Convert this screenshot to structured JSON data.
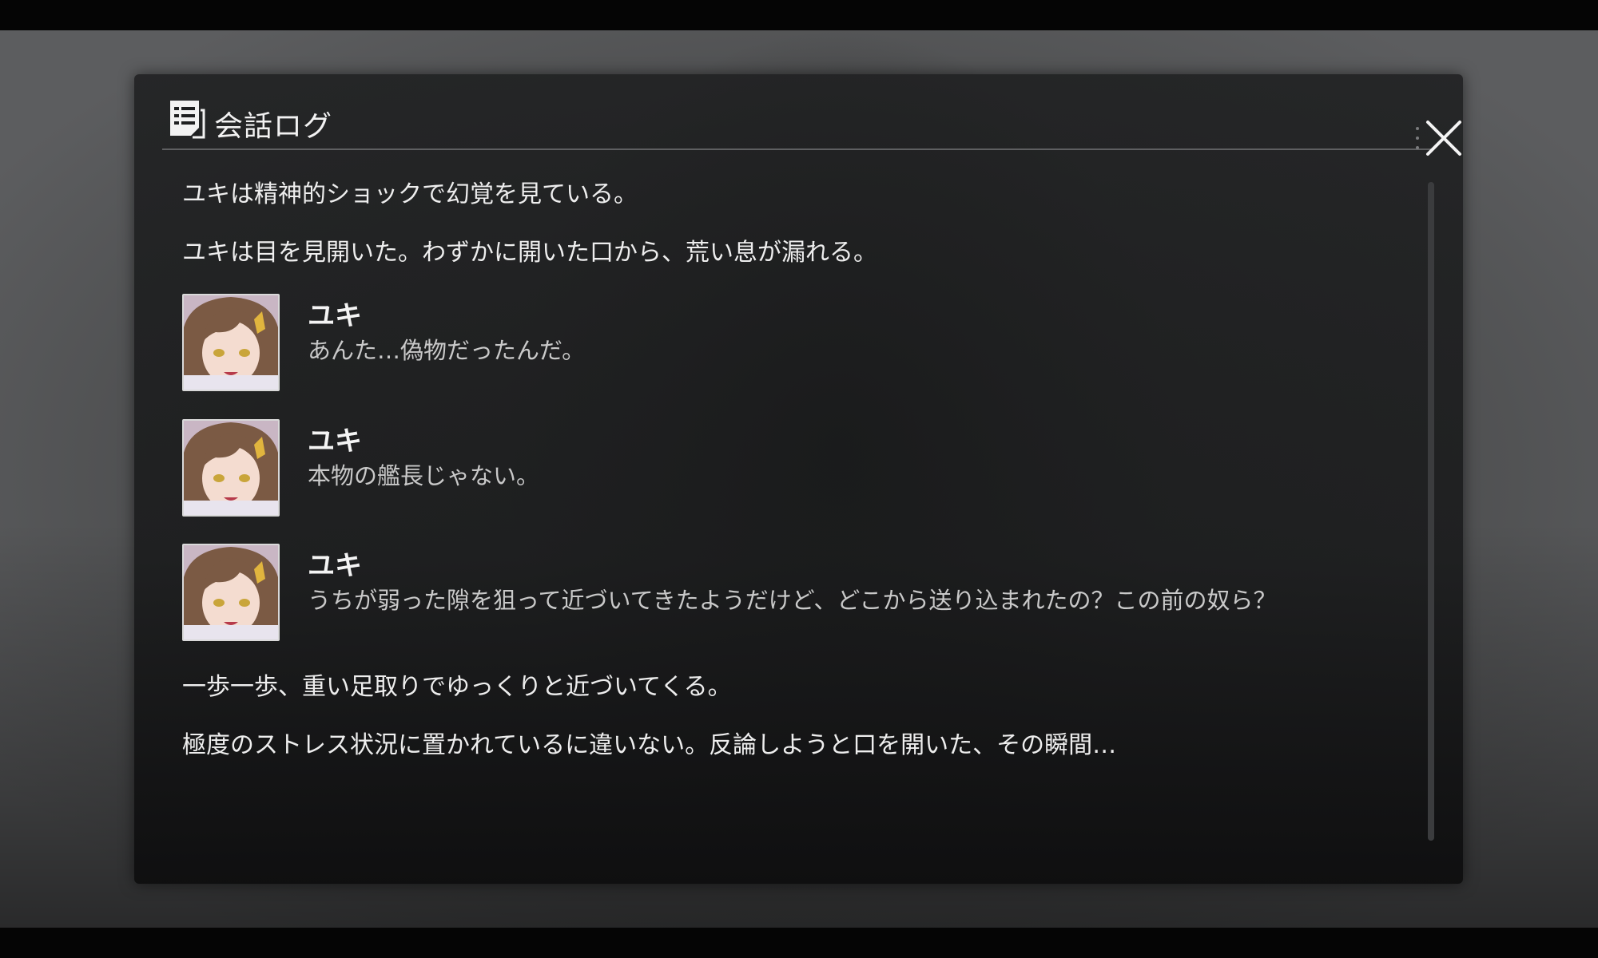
{
  "log_panel": {
    "title": "会話ログ",
    "entries": [
      {
        "type": "narration",
        "text": "ユキは精神的ショックで幻覚を見ている。"
      },
      {
        "type": "narration",
        "text": "ユキは目を見開いた。わずかに開いた口から、荒い息が漏れる。"
      },
      {
        "type": "dialogue",
        "speaker": "ユキ",
        "text": "あんた…偽物だったんだ。"
      },
      {
        "type": "dialogue",
        "speaker": "ユキ",
        "text": "本物の艦長じゃない。"
      },
      {
        "type": "dialogue",
        "speaker": "ユキ",
        "text": "うちが弱った隙を狙って近づいてきたようだけど、どこから送り込まれたの？この前の奴ら？"
      },
      {
        "type": "narration",
        "text": "一歩一歩、重い足取りでゆっくりと近づいてくる。"
      },
      {
        "type": "narration",
        "text": "極度のストレス状況に置かれているに違いない。反論しようと口を開いた、その瞬間…"
      }
    ]
  },
  "icons": {
    "log": "log-document-icon",
    "close": "close-icon",
    "portrait": "yuki-portrait"
  },
  "colors": {
    "panel_bg": "#1e1f20",
    "text_primary": "#eeeeee",
    "text_dialogue": "#c9c9c9",
    "divider": "#5e5f61"
  }
}
